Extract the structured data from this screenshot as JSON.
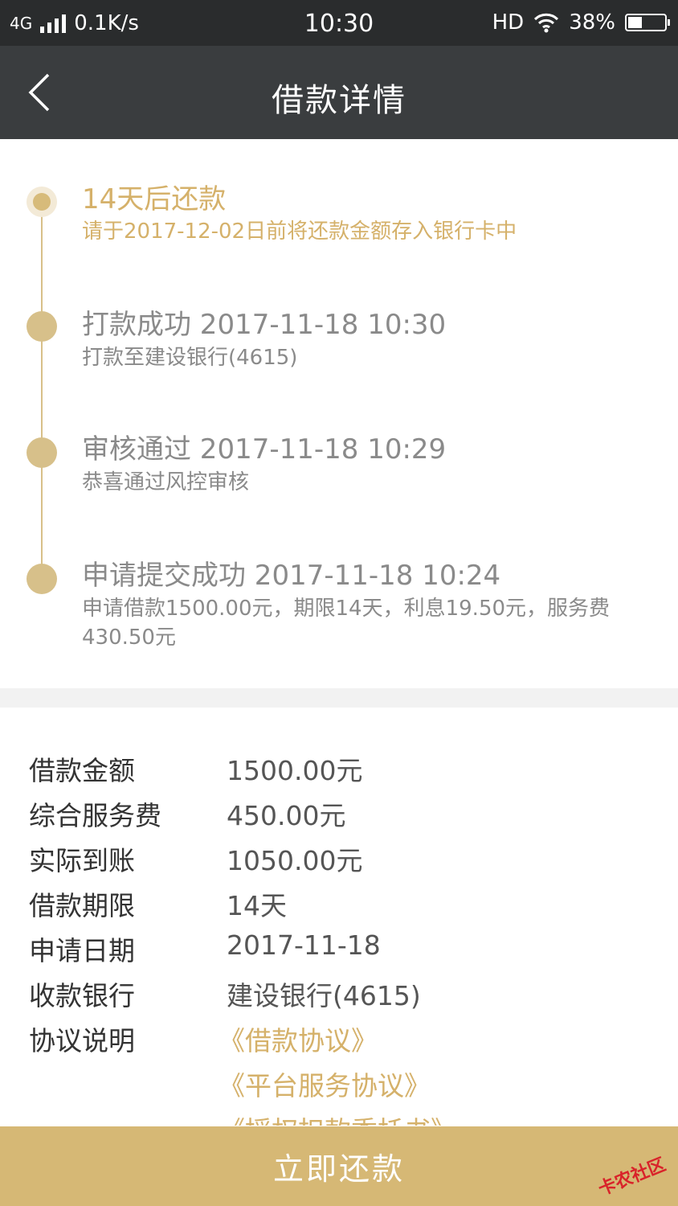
{
  "status_bar": {
    "network": "4G",
    "speed": "0.1K/s",
    "time": "10:30",
    "hd": "HD",
    "battery": "38%",
    "battery_level": 0.38,
    "icons": [
      "signal-icon",
      "wifi-icon",
      "battery-icon"
    ]
  },
  "nav": {
    "title": "借款详情",
    "back_icon": "chevron-left-icon"
  },
  "timeline": [
    {
      "title": "14天后还款",
      "desc": "请于2017-12-02日前将还款金额存入银行卡中",
      "active": true
    },
    {
      "title": "打款成功 2017-11-18 10:30",
      "desc": "打款至建设银行(4615)"
    },
    {
      "title": "审核通过 2017-11-18 10:29",
      "desc": "恭喜通过风控审核"
    },
    {
      "title": "申请提交成功 2017-11-18 10:24",
      "desc": "申请借款1500.00元，期限14天，利息19.50元，服务费430.50元"
    }
  ],
  "details": [
    {
      "label": "借款金额",
      "value": "1500.00元"
    },
    {
      "label": "综合服务费",
      "value": "450.00元"
    },
    {
      "label": "实际到账",
      "value": "1050.00元"
    },
    {
      "label": "借款期限",
      "value": "14天"
    },
    {
      "label": "申请日期",
      "value": "2017-11-18"
    },
    {
      "label": "收款银行",
      "value": "建设银行(4615)"
    }
  ],
  "agreements": {
    "label": "协议说明",
    "items": [
      "《借款协议》",
      "《平台服务协议》",
      "《授权扣款委托书》"
    ]
  },
  "repay_button": "立即还款",
  "watermark": "卡农社区",
  "colors": {
    "accent": "#d5b16a",
    "status_bar": "#2a2c2d",
    "nav_bar": "#3a3d3f",
    "button": "#d6b875"
  }
}
